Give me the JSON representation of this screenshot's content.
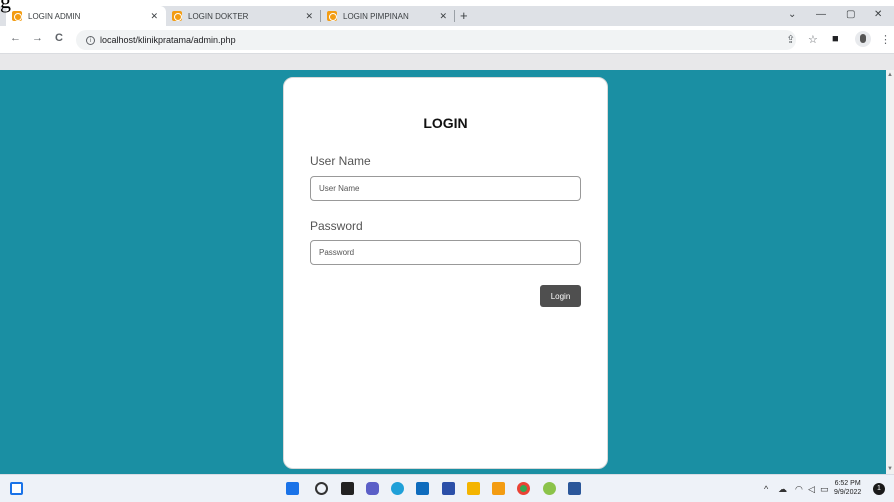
{
  "browser": {
    "tabs": [
      {
        "label": "LOGIN ADMIN",
        "active": true
      },
      {
        "label": "LOGIN DOKTER",
        "active": false
      },
      {
        "label": "LOGIN PIMPINAN",
        "active": false
      }
    ],
    "new_tab": "+",
    "url": "localhost/klinikpratama/admin.php",
    "icons": {
      "back": "←",
      "forward": "→",
      "reload": "C",
      "share": "⇪",
      "star": "☆",
      "sidepanel": "■",
      "menu": "⋮",
      "minimize": "—",
      "restore": "▢",
      "close": "✕",
      "dropdown": "⌄"
    }
  },
  "fragment_text": "g",
  "login": {
    "title": "LOGIN",
    "username_label": "User Name",
    "username_placeholder": "User Name",
    "password_label": "Password",
    "password_placeholder": "Password",
    "submit_label": "Login"
  },
  "colors": {
    "page_bg": "#1a8fa3",
    "button_bg": "#4f4f4f",
    "card_bg": "#ffffff"
  },
  "taskbar": {
    "time": "6:52 PM",
    "date": "9/9/2022",
    "notifications": "1",
    "tray_icons": [
      "chevron-up-icon",
      "onedrive-icon",
      "wifi-icon",
      "volume-icon",
      "battery-icon"
    ]
  }
}
